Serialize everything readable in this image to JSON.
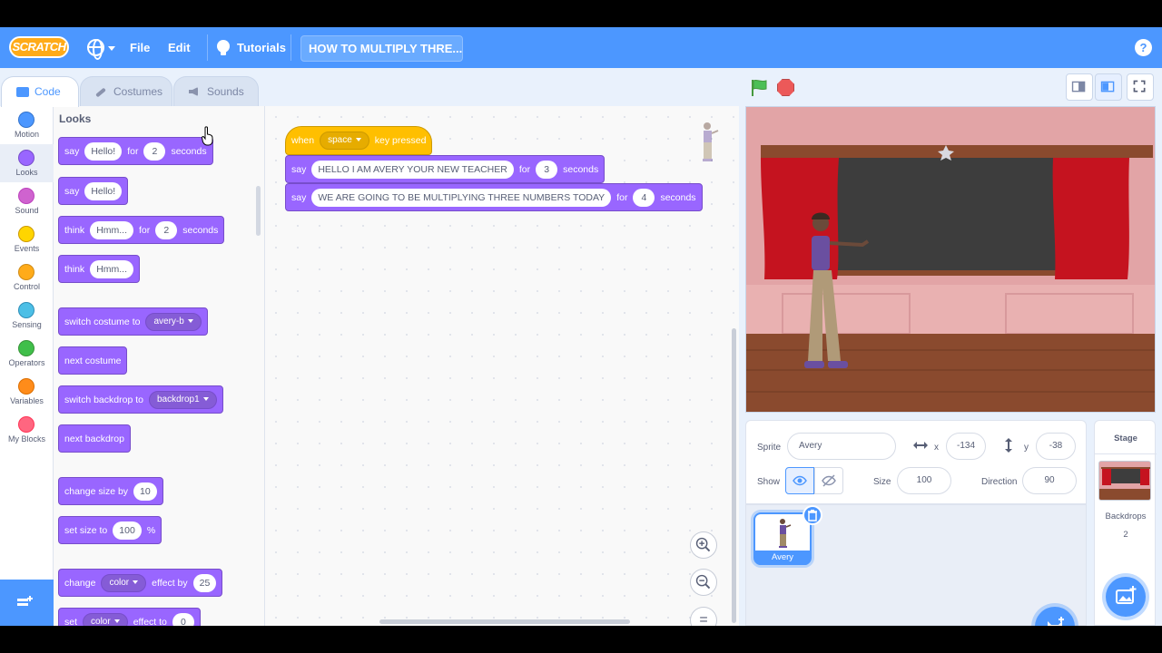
{
  "menubar": {
    "logo_text": "SCRATCH",
    "file": "File",
    "edit": "Edit",
    "tutorials": "Tutorials",
    "project_title": "HOW TO MULTIPLY THRE...",
    "help": "?"
  },
  "tabs": {
    "code": "Code",
    "costumes": "Costumes",
    "sounds": "Sounds"
  },
  "categories": [
    {
      "label": "Motion",
      "color": "#4c97ff"
    },
    {
      "label": "Looks",
      "color": "#9966ff"
    },
    {
      "label": "Sound",
      "color": "#cf63cf"
    },
    {
      "label": "Events",
      "color": "#ffd500"
    },
    {
      "label": "Control",
      "color": "#ffab19"
    },
    {
      "label": "Sensing",
      "color": "#4cbfe6"
    },
    {
      "label": "Operators",
      "color": "#40bf4a"
    },
    {
      "label": "Variables",
      "color": "#ff8c1a"
    },
    {
      "label": "My Blocks",
      "color": "#ff6680"
    }
  ],
  "palette": {
    "title": "Looks",
    "say_for": {
      "say": "say",
      "msg": "Hello!",
      "for": "for",
      "secs": "2",
      "seconds": "seconds"
    },
    "say": {
      "say": "say",
      "msg": "Hello!"
    },
    "think_for": {
      "think": "think",
      "msg": "Hmm...",
      "for": "for",
      "secs": "2",
      "seconds": "seconds"
    },
    "think": {
      "think": "think",
      "msg": "Hmm..."
    },
    "switch_costume": {
      "label": "switch costume to",
      "value": "avery-b"
    },
    "next_costume": "next costume",
    "switch_backdrop": {
      "label": "switch backdrop to",
      "value": "backdrop1"
    },
    "next_backdrop": "next backdrop",
    "change_size": {
      "label": "change size by",
      "value": "10"
    },
    "set_size": {
      "label": "set size to",
      "value": "100",
      "unit": "%"
    },
    "change_effect": {
      "change": "change",
      "effect": "color",
      "by": "effect by",
      "value": "25"
    },
    "set_effect": {
      "set": "set",
      "effect": "color",
      "to": "effect to",
      "value": "0"
    }
  },
  "script": {
    "hat": {
      "when": "when",
      "key": "space",
      "pressed": "key pressed"
    },
    "say1": {
      "say": "say",
      "msg": "HELLO I AM AVERY YOUR NEW TEACHER",
      "for": "for",
      "secs": "3",
      "seconds": "seconds"
    },
    "say2": {
      "say": "say",
      "msg": "WE ARE GOING TO BE MULTIPLYING THREE NUMBERS TODAY",
      "for": "for",
      "secs": "4",
      "seconds": "seconds"
    }
  },
  "zoom": {
    "reset": "="
  },
  "sprite_info": {
    "sprite_label": "Sprite",
    "sprite_name": "Avery",
    "x_label": "x",
    "x": "-134",
    "y_label": "y",
    "y": "-38",
    "show_label": "Show",
    "size_label": "Size",
    "size": "100",
    "direction_label": "Direction",
    "direction": "90"
  },
  "sprites": [
    {
      "name": "Avery"
    }
  ],
  "stage_panel": {
    "title": "Stage",
    "backdrops_label": "Backdrops",
    "backdrops_count": "2"
  },
  "colors": {
    "menubar": "#4c97ff",
    "looks": "#9966ff",
    "events": "#ffbf00",
    "stop": "#ec5959",
    "flag": "#4cbf56"
  }
}
